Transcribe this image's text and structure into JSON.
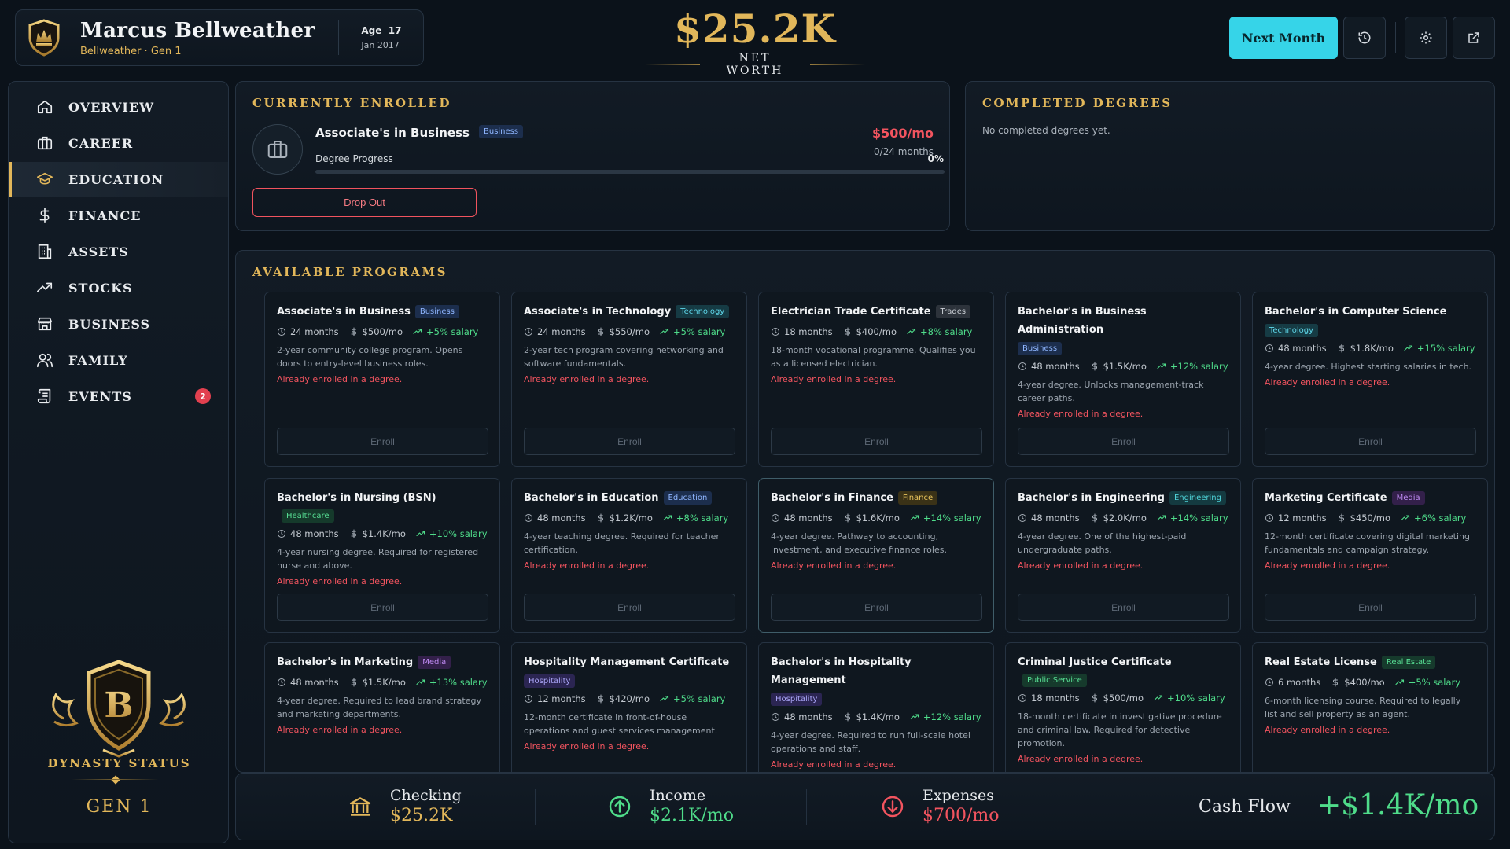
{
  "player": {
    "name": "Marcus Bellweather",
    "family_line": "Bellweather · Gen 1",
    "age_label": "Age",
    "age_value": "17",
    "date": "Jan 2017"
  },
  "networth": {
    "value": "$25.2K",
    "label": "NET WORTH"
  },
  "header": {
    "next_month_label": "Next Month",
    "icons": [
      "history-icon",
      "gear-icon",
      "external-link-icon"
    ]
  },
  "sidebar": {
    "items": [
      {
        "label": "OVERVIEW",
        "icon": "home-icon",
        "active": false
      },
      {
        "label": "CAREER",
        "icon": "briefcase-icon",
        "active": false
      },
      {
        "label": "EDUCATION",
        "icon": "graduation-cap-icon",
        "active": true
      },
      {
        "label": "FINANCE",
        "icon": "dollar-icon",
        "active": false
      },
      {
        "label": "ASSETS",
        "icon": "building-icon",
        "active": false
      },
      {
        "label": "STOCKS",
        "icon": "trend-up-icon",
        "active": false
      },
      {
        "label": "BUSINESS",
        "icon": "store-icon",
        "active": false
      },
      {
        "label": "FAMILY",
        "icon": "users-icon",
        "active": false
      },
      {
        "label": "EVENTS",
        "icon": "scroll-icon",
        "active": false,
        "badge": "2"
      }
    ],
    "dynasty_letter": "B",
    "dynasty_label": "DYNASTY STATUS",
    "dynasty_gen": "GEN 1"
  },
  "enrolled": {
    "title": "CURRENTLY ENROLLED",
    "program": "Associate's in Business",
    "tag": "Business",
    "progress_label": "Degree Progress",
    "progress_text": "0%",
    "progress_fraction": 0,
    "cost": "$500/mo",
    "months": "0/24 months",
    "drop_label": "Drop Out"
  },
  "completed": {
    "title": "COMPLETED DEGREES",
    "empty_text": "No completed degrees yet."
  },
  "programs": {
    "title": "AVAILABLE PROGRAMS",
    "enroll_label": "Enroll",
    "warning": "Already enrolled in a degree.",
    "tag_colors": {
      "Business": {
        "bg": "#1c2e4d",
        "fg": "#8fb6ff"
      },
      "Technology": {
        "bg": "#163b44",
        "fg": "#5fd7ea"
      },
      "Trades": {
        "bg": "#2d333b",
        "fg": "#c9ced4"
      },
      "Healthcare": {
        "bg": "#153a2b",
        "fg": "#57dd93"
      },
      "Education": {
        "bg": "#1c2e4d",
        "fg": "#8fb6ff"
      },
      "Finance": {
        "bg": "#3a3217",
        "fg": "#e7c35c"
      },
      "Engineering": {
        "bg": "#143a40",
        "fg": "#4fd3d8"
      },
      "Media": {
        "bg": "#33204a",
        "fg": "#c18cf5"
      },
      "Hospitality": {
        "bg": "#2b2552",
        "fg": "#a9a4f6"
      },
      "Public Service": {
        "bg": "#163a2c",
        "fg": "#57dd93"
      },
      "Real Estate": {
        "bg": "#163a2c",
        "fg": "#57dd93"
      }
    },
    "items": [
      {
        "name": "Associate's in Business",
        "tag": "Business",
        "months": "24 months",
        "cost": "$500/mo",
        "salary": "+5% salary",
        "desc": "2-year community college program. Opens doors to entry-level business roles."
      },
      {
        "name": "Associate's in Technology",
        "tag": "Technology",
        "months": "24 months",
        "cost": "$550/mo",
        "salary": "+5% salary",
        "desc": "2-year tech program covering networking and software fundamentals."
      },
      {
        "name": "Electrician Trade Certificate",
        "tag": "Trades",
        "months": "18 months",
        "cost": "$400/mo",
        "salary": "+8% salary",
        "desc": "18-month vocational programme. Qualifies you as a licensed electrician."
      },
      {
        "name": "Bachelor's in Business Administration",
        "tag": "Business",
        "tag_below": true,
        "months": "48 months",
        "cost": "$1.5K/mo",
        "salary": "+12% salary",
        "desc": "4-year degree. Unlocks management-track career paths."
      },
      {
        "name": "Bachelor's in Computer Science",
        "tag": "Technology",
        "tag_below": true,
        "months": "48 months",
        "cost": "$1.8K/mo",
        "salary": "+15% salary",
        "desc": "4-year degree. Highest starting salaries in tech."
      },
      {
        "name": "Bachelor's in Nursing (BSN)",
        "tag": "Healthcare",
        "months": "48 months",
        "cost": "$1.4K/mo",
        "salary": "+10% salary",
        "desc": "4-year nursing degree. Required for registered nurse and above."
      },
      {
        "name": "Bachelor's in Education",
        "tag": "Education",
        "months": "48 months",
        "cost": "$1.2K/mo",
        "salary": "+8% salary",
        "desc": "4-year teaching degree. Required for teacher certification."
      },
      {
        "name": "Bachelor's in Finance",
        "tag": "Finance",
        "months": "48 months",
        "cost": "$1.6K/mo",
        "salary": "+14% salary",
        "desc": "4-year degree. Pathway to accounting, investment, and executive finance roles.",
        "highlight": true
      },
      {
        "name": "Bachelor's in Engineering",
        "tag": "Engineering",
        "months": "48 months",
        "cost": "$2.0K/mo",
        "salary": "+14% salary",
        "desc": "4-year degree. One of the highest-paid undergraduate paths."
      },
      {
        "name": "Marketing Certificate",
        "tag": "Media",
        "months": "12 months",
        "cost": "$450/mo",
        "salary": "+6% salary",
        "desc": "12-month certificate covering digital marketing fundamentals and campaign strategy."
      },
      {
        "name": "Bachelor's in Marketing",
        "tag": "Media",
        "months": "48 months",
        "cost": "$1.5K/mo",
        "salary": "+13% salary",
        "desc": "4-year degree. Required to lead brand strategy and marketing departments."
      },
      {
        "name": "Hospitality Management Certificate",
        "tag": "Hospitality",
        "tag_below": true,
        "months": "12 months",
        "cost": "$420/mo",
        "salary": "+5% salary",
        "desc": "12-month certificate in front-of-house operations and guest services management."
      },
      {
        "name": "Bachelor's in Hospitality Management",
        "tag": "Hospitality",
        "tag_below": true,
        "months": "48 months",
        "cost": "$1.4K/mo",
        "salary": "+12% salary",
        "desc": "4-year degree. Required to run full-scale hotel operations and staff."
      },
      {
        "name": "Criminal Justice Certificate",
        "tag": "Public Service",
        "months": "18 months",
        "cost": "$500/mo",
        "salary": "+10% salary",
        "desc": "18-month certificate in investigative procedure and criminal law. Required for detective promotion."
      },
      {
        "name": "Real Estate License",
        "tag": "Real Estate",
        "months": "6 months",
        "cost": "$400/mo",
        "salary": "+5% salary",
        "desc": "6-month licensing course. Required to legally list and sell property as an agent."
      }
    ]
  },
  "footer": {
    "checking_label": "Checking",
    "checking_value": "$25.2K",
    "income_label": "Income",
    "income_value": "$2.1K/mo",
    "expenses_label": "Expenses",
    "expenses_value": "$700/mo",
    "cashflow_label": "Cash Flow",
    "cashflow_value": "+$1.4K/mo"
  },
  "colors": {
    "gold": "#e2b75a",
    "accent_cyan": "#36d4e8",
    "positive": "#4fdc8a",
    "negative": "#f2545f"
  }
}
